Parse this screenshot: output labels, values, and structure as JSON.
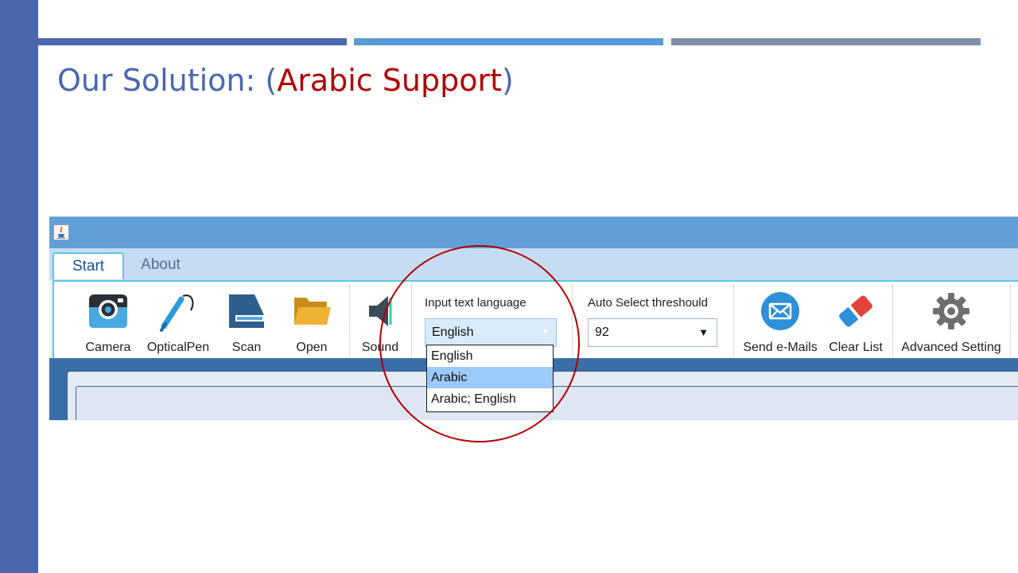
{
  "slide": {
    "title_main": "Our Solution: (",
    "title_highlight": "Arabic Support",
    "title_end": ")",
    "colors": {
      "accent_blue": "#4a67ad",
      "highlight_red": "#b00000"
    }
  },
  "window": {
    "icon": "java-icon"
  },
  "tabs": [
    {
      "label": "Start",
      "active": true
    },
    {
      "label": "About",
      "active": false
    }
  ],
  "toolbar": {
    "tools": [
      {
        "label": "Camera",
        "icon": "camera-icon"
      },
      {
        "label": "OpticalPen",
        "icon": "optical-pen-icon"
      },
      {
        "label": "Scan",
        "icon": "scanner-icon"
      },
      {
        "label": "Open",
        "icon": "folder-icon"
      },
      {
        "label": "Sound",
        "icon": "speaker-icon"
      }
    ],
    "language": {
      "label": "Input text language",
      "value": "English",
      "options": [
        "English",
        "Arabic",
        "Arabic; English"
      ],
      "highlighted_option": "Arabic"
    },
    "threshold": {
      "label": "Auto Select threshould",
      "value": "92"
    },
    "actions": [
      {
        "label": "Send e-Mails",
        "icon": "mail-icon"
      },
      {
        "label": "Clear List",
        "icon": "eraser-icon"
      },
      {
        "label": "Advanced Setting",
        "icon": "gear-icon"
      }
    ]
  }
}
